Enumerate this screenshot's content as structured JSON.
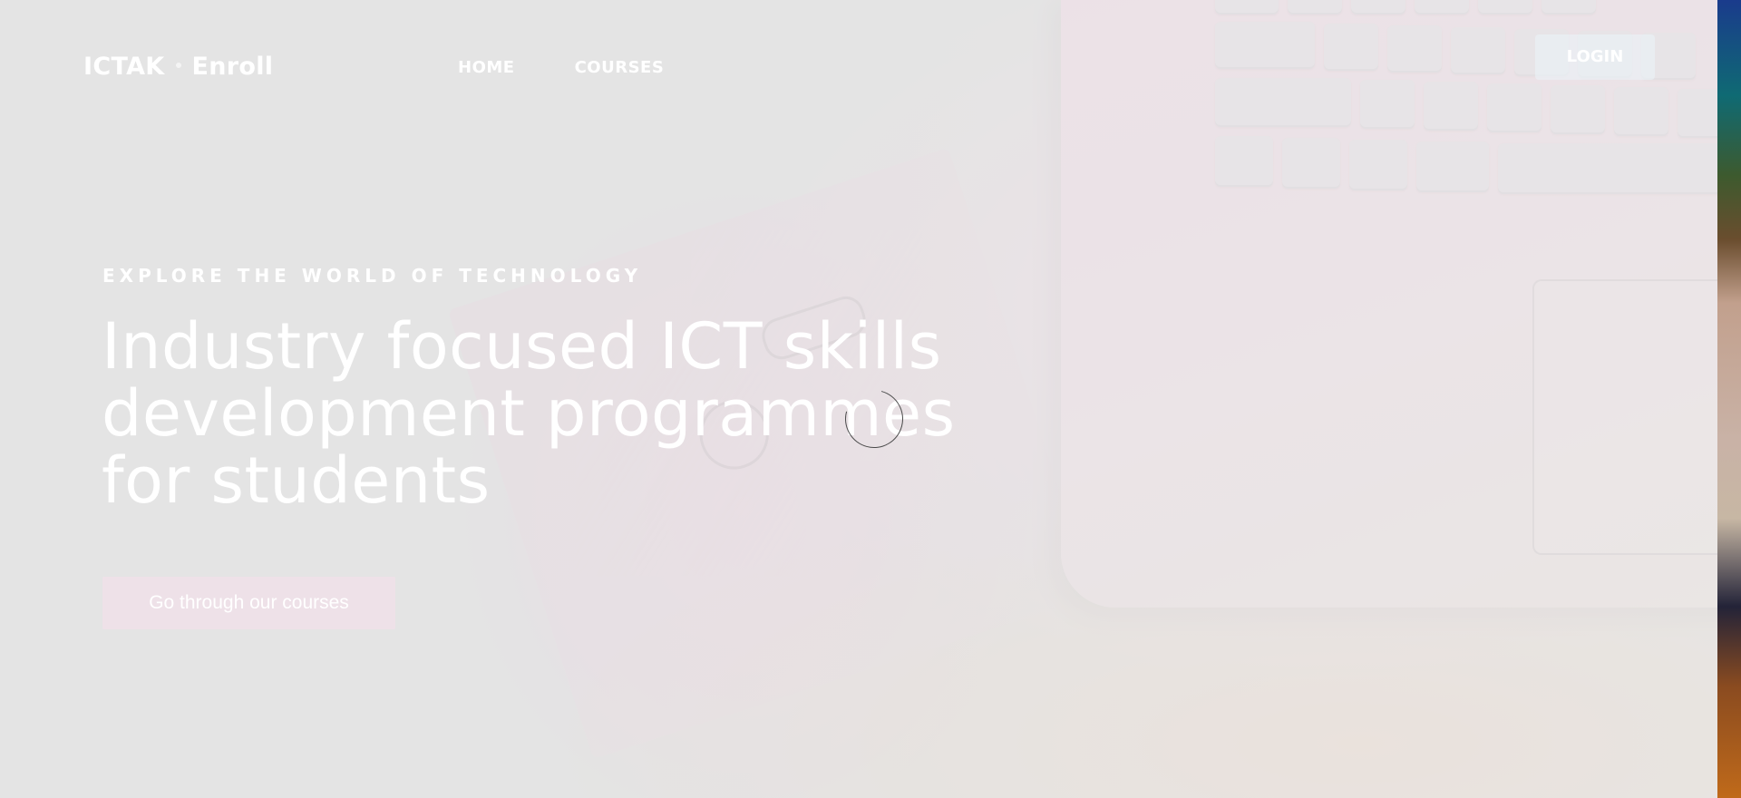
{
  "navbar": {
    "brand_primary": "ICTAK",
    "brand_secondary": "Enroll",
    "links": [
      "HOME",
      "COURSES"
    ],
    "login_label": "LOGIN"
  },
  "hero": {
    "kicker": "EXPLORE THE WORLD OF TECHNOLOGY",
    "title": "Industry focused ICT skills development programmes for students",
    "cta_label": "Go through our courses"
  },
  "loading": {
    "icon": "spinner-icon"
  },
  "colors": {
    "overlay": "#e6e6e6",
    "text": "#ffffff",
    "accent_pink": "#fbe0ee"
  }
}
